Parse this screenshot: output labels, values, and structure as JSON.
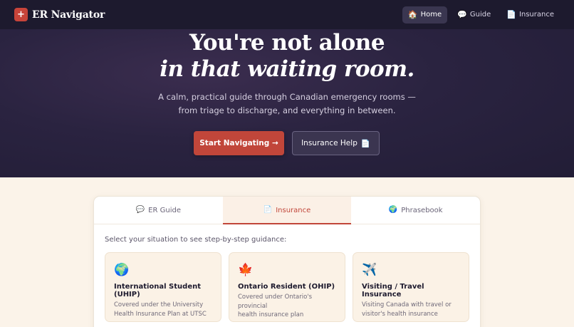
{
  "navbar": {
    "brand_icon": "+",
    "brand_name": "ER Navigator",
    "links": [
      {
        "icon": "🏠",
        "icon_name": "home-icon",
        "label": "Home",
        "active": true
      },
      {
        "icon": "💬",
        "icon_name": "speech-bubble-icon",
        "label": "Guide",
        "active": false
      },
      {
        "icon": "📄",
        "icon_name": "document-icon",
        "label": "Insurance",
        "active": false
      }
    ]
  },
  "hero": {
    "title_line1": "You're not alone",
    "title_line2": "in that waiting room.",
    "subtitle_line1": "A calm, practical guide through Canadian emergency rooms —",
    "subtitle_line2": "from triage to discharge, and everything in between.",
    "primary_button": "Start Navigating →",
    "secondary_button": "Insurance Help",
    "secondary_button_icon": "📄"
  },
  "tabs": [
    {
      "icon": "💬",
      "icon_name": "speech-bubble-icon",
      "label": "ER Guide",
      "active": false
    },
    {
      "icon": "📄",
      "icon_name": "document-icon",
      "label": "Insurance",
      "active": true
    },
    {
      "icon": "🌍",
      "icon_name": "globe-icon",
      "label": "Phrasebook",
      "active": false
    }
  ],
  "insurance": {
    "prompt": "Select your situation to see step-by-step guidance:",
    "options": [
      {
        "icon": "🌍",
        "icon_name": "globe-icon",
        "title": "International Student (UHIP)",
        "desc_line1": "Covered under the University",
        "desc_line2": "Health Insurance Plan at UTSC"
      },
      {
        "icon": "🍁",
        "icon_name": "maple-leaf-icon",
        "title": "Ontario Resident (OHIP)",
        "desc_line1": "Covered under Ontario's provincial",
        "desc_line2": "health insurance plan"
      },
      {
        "icon": "✈️",
        "icon_name": "airplane-icon",
        "title": "Visiting / Travel Insurance",
        "desc_line1": "Visiting Canada with travel or",
        "desc_line2": "visitor's health insurance"
      }
    ]
  },
  "colors": {
    "navbar_bg": "#1d1a2e",
    "accent": "#c1463a",
    "page_bg": "#fbf3e9"
  }
}
